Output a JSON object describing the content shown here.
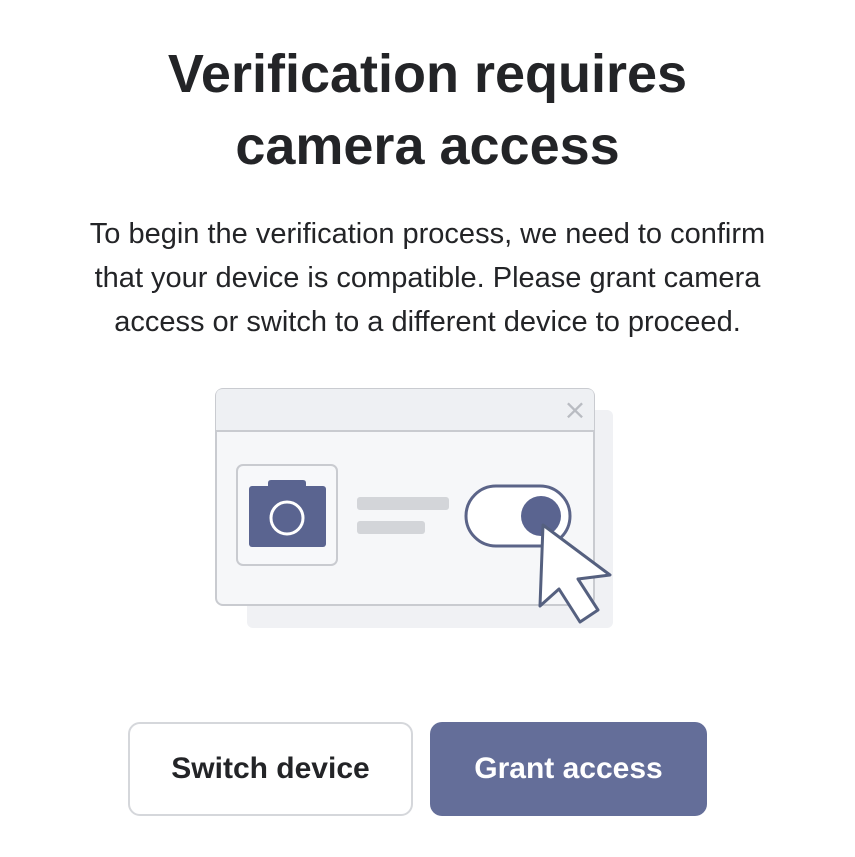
{
  "heading": {
    "line1": "Verification requires",
    "line2": "camera access"
  },
  "description": {
    "line1": "To begin the verification process, we need to confirm",
    "line2": "that your device is compatible. Please grant camera",
    "line3": "access or switch to a different device to proceed."
  },
  "illustration": {
    "close_glyph": "×",
    "icons": [
      "camera-icon",
      "toggle-switch-icon",
      "cursor-arrow-icon"
    ]
  },
  "buttons": {
    "switch_device": "Switch device",
    "grant_access": "Grant access"
  },
  "colors": {
    "primary": "#646e99",
    "icon_fill": "#5a6490",
    "secondary_border": "#d5d7db",
    "text": "#232427"
  }
}
